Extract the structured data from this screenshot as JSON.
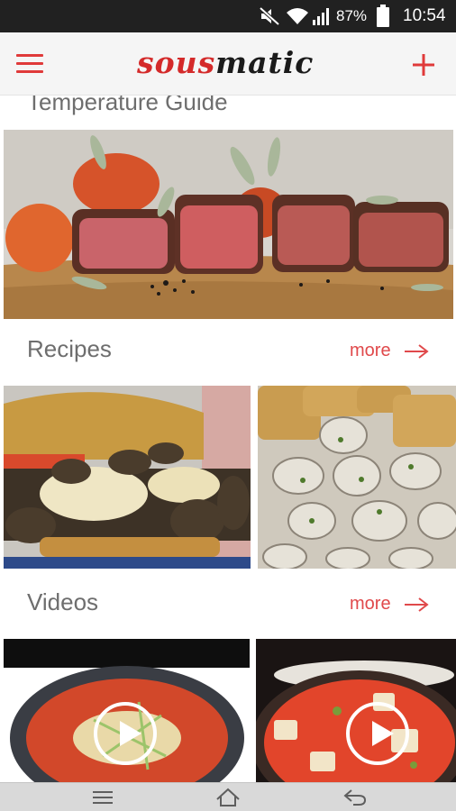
{
  "status_bar": {
    "battery_percent": "87%",
    "time": "10:54",
    "icons": [
      "mute-icon",
      "wifi-icon",
      "signal-icon",
      "battery-icon"
    ]
  },
  "app_bar": {
    "logo_part1": "sous",
    "logo_part2": "matic",
    "menu_icon": "hamburger-menu-icon",
    "add_icon": "plus-icon",
    "accent_color": "#e03a3a"
  },
  "sections": {
    "temperature_guide": {
      "title": "Temperature Guide"
    },
    "recipes": {
      "title": "Recipes",
      "more_label": "more",
      "items": [
        {
          "image": "burger-with-mushrooms"
        },
        {
          "image": "clams-with-garlic-bread"
        }
      ]
    },
    "videos": {
      "title": "Videos",
      "more_label": "more",
      "items": [
        {
          "image": "noodle-soup",
          "icon": "play-icon"
        },
        {
          "image": "kimchi-stew",
          "icon": "play-icon"
        }
      ]
    }
  },
  "nav_bar": {
    "icons": [
      "recent-apps-icon",
      "home-icon",
      "back-icon"
    ]
  }
}
